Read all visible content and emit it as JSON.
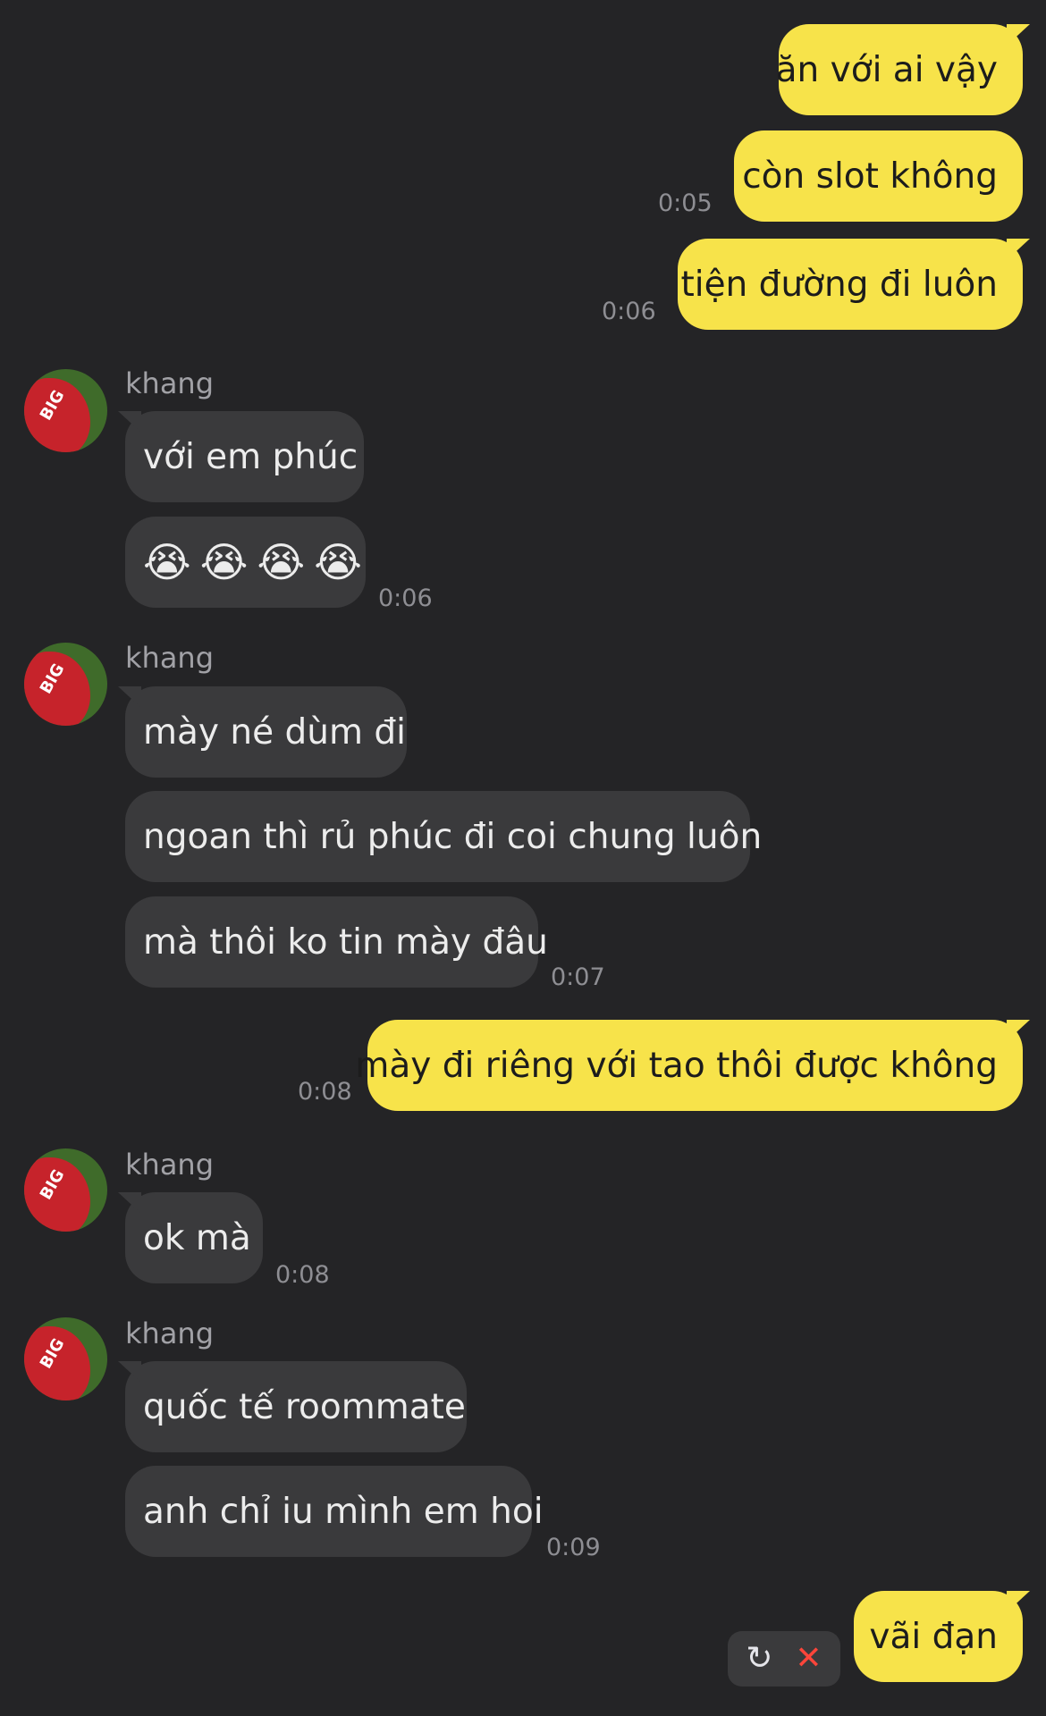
{
  "messages": [
    {
      "text": "ăn với ai vậy"
    },
    {
      "text": "còn slot không",
      "time": "0:05"
    },
    {
      "text": "tiện đường đi luôn",
      "time": "0:06"
    },
    {
      "sender": "khang"
    },
    {
      "text": "với em phúc"
    },
    {
      "emojis": [
        "😭",
        "😭",
        "😭",
        "😭"
      ],
      "time": "0:06"
    },
    {
      "sender": "khang"
    },
    {
      "text": "mày né dùm đi"
    },
    {
      "text": "ngoan thì rủ phúc đi coi chung luôn"
    },
    {
      "text": "mà thôi ko tin mày đâu",
      "time": "0:07"
    },
    {
      "text": "mày đi riêng với tao thôi được không",
      "time": "0:08"
    },
    {
      "sender": "khang"
    },
    {
      "text": "ok mà",
      "time": "0:08"
    },
    {
      "sender": "khang"
    },
    {
      "text": "quốc tế roommate"
    },
    {
      "text": "anh chỉ iu mình em hoi",
      "time": "0:09"
    },
    {
      "text": "vãi đạn"
    }
  ],
  "actions": {
    "retry_icon": "↻",
    "cancel_icon": "✕"
  },
  "colors": {
    "background": "#242426",
    "outgoing": "#f7e34a",
    "incoming": "#3a3a3c",
    "failed": "#ff453a"
  }
}
